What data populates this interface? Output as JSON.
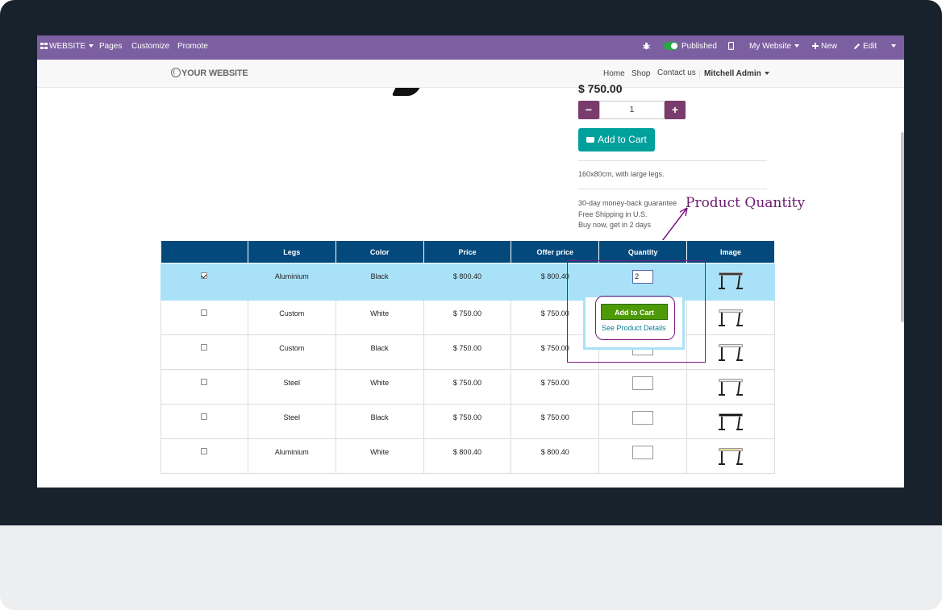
{
  "admin_bar": {
    "website_label": "WEBSITE",
    "pages": "Pages",
    "customize": "Customize",
    "promote": "Promote",
    "published": "Published",
    "my_website": "My Website",
    "new": "New",
    "edit": "Edit",
    "bg_color": "#7c5fa0"
  },
  "site_nav": {
    "logo_text": "YOUR WEBSITE",
    "links": [
      "Home",
      "Shop",
      "Contact us"
    ],
    "user": "Mitchell Admin"
  },
  "product": {
    "price": "$ 750.00",
    "quantity": "1",
    "add_to_cart": "Add to Cart",
    "description": "160x80cm, with large legs.",
    "terms": [
      "30-day money-back guarantee",
      "Free Shipping in U.S.",
      "Buy now, get in 2 days"
    ]
  },
  "annotation": {
    "label": "Product  Quantity",
    "color": "#7a1a7e"
  },
  "variant_table": {
    "headers": [
      "",
      "Legs",
      "Color",
      "Price",
      "Offer price",
      "Quantity",
      "Image"
    ],
    "header_color": "#03497c",
    "selected_row_color": "#a9e2f8",
    "rows": [
      {
        "checked": true,
        "legs": "Aluminium",
        "color": "Black",
        "price": "$ 800.40",
        "offer": "$ 800.40",
        "qty": "2",
        "desk_top_color": "#3a3a3a"
      },
      {
        "checked": false,
        "legs": "Custom",
        "color": "White",
        "price": "$ 750.00",
        "offer": "$ 750.00",
        "qty": "",
        "desk_top_color": "#e8e8e8"
      },
      {
        "checked": false,
        "legs": "Custom",
        "color": "Black",
        "price": "$ 750.00",
        "offer": "$ 750.00",
        "qty": "",
        "desk_top_color": "#e8e8e8"
      },
      {
        "checked": false,
        "legs": "Steel",
        "color": "White",
        "price": "$ 750.00",
        "offer": "$ 750.00",
        "qty": "",
        "desk_top_color": "#e8e8e8"
      },
      {
        "checked": false,
        "legs": "Steel",
        "color": "Black",
        "price": "$ 750.00",
        "offer": "$ 750.00",
        "qty": "",
        "desk_top_color": "#111111"
      },
      {
        "checked": false,
        "legs": "Aluminium",
        "color": "White",
        "price": "$ 800.40",
        "offer": "$ 800.40",
        "qty": "",
        "desk_top_color": "#e9dca2"
      }
    ]
  },
  "popup": {
    "add_to_cart": "Add to Cart",
    "details_link": "See Product Details",
    "button_color": "#4e9a06"
  },
  "icons": [
    "apps-grid-icon",
    "bug-icon",
    "mobile-icon",
    "plus-icon",
    "pencil-icon",
    "globe-icon",
    "cart-icon",
    "minus-icon"
  ]
}
